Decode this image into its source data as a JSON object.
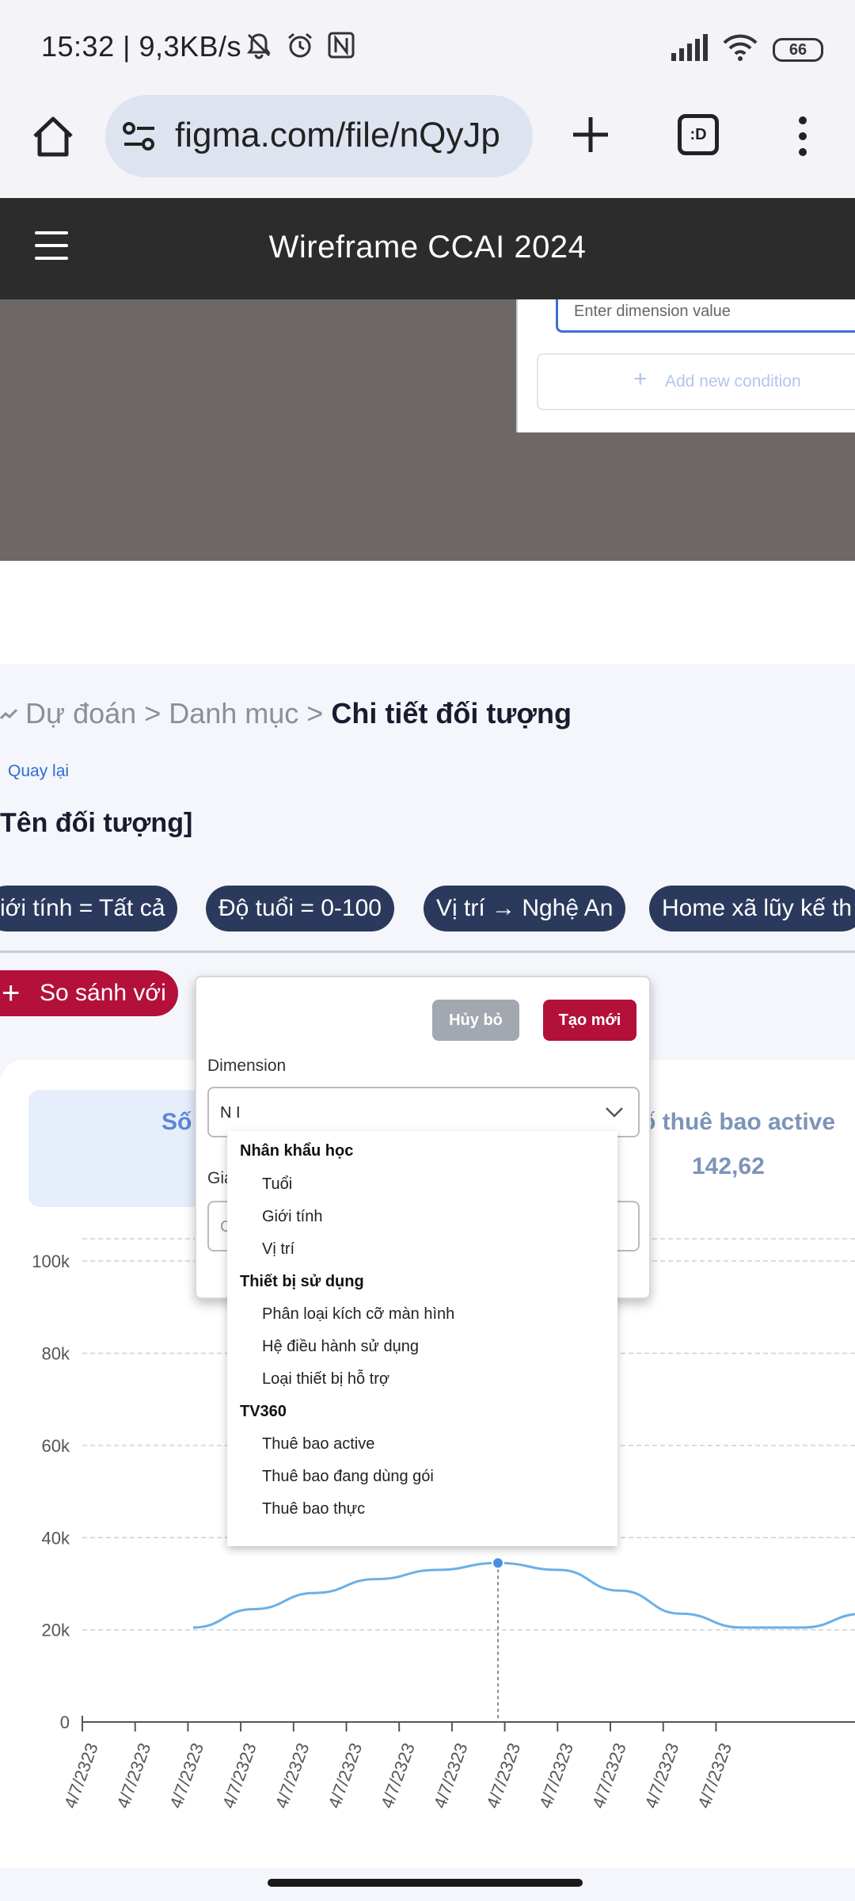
{
  "status_bar": {
    "time_speed": "15:32 | 9,3KB/s",
    "battery": "66",
    "icons": [
      "bell-off-icon",
      "alarm-icon",
      "nfc-icon",
      "signal-icon",
      "wifi-icon"
    ]
  },
  "browser": {
    "url": "figma.com/file/nQyJp",
    "tabs_label": ":D"
  },
  "app_header": {
    "title": "Wireframe CCAI 2024"
  },
  "figma_canvas": {
    "dimension_placeholder": "Enter dimension value",
    "add_condition": "Add new condition"
  },
  "page": {
    "breadcrumb_prefix": "Dự đoán > Danh mục > ",
    "breadcrumb_current": "Chi tiết đối tượng",
    "back": "Quay lại",
    "object_name": "Tên đối tượng]",
    "chips": [
      "iới tính = Tất cả",
      "Độ tuổi = 0-100",
      "Vị trí → Nghệ An",
      "Home xã lũy kế th"
    ],
    "compare_button": "So sánh với",
    "kpi_left_label": "Số",
    "kpi_right_label": "ố thuê bao active",
    "kpi_right_value": "142,62"
  },
  "popup": {
    "cancel": "Hủy bỏ",
    "create": "Tạo mới",
    "dimension_label": "Dimension",
    "dimension_value": "N I",
    "second_label": "Giá",
    "second_placeholder": "C"
  },
  "dropdown": {
    "groups": [
      {
        "title": "Nhân khẩu học",
        "items": [
          "Tuổi",
          "Giới tính",
          "Vị trí"
        ]
      },
      {
        "title": "Thiết bị sử dụng",
        "items": [
          "Phân loại kích cỡ màn hình",
          "Hệ điều hành sử dụng",
          "Loại thiết bị hỗ trợ"
        ]
      },
      {
        "title": "TV360",
        "items": [
          "Thuê bao active",
          "Thuê bao đang dùng gói",
          "Thuê bao thực"
        ]
      }
    ]
  },
  "chart_data": {
    "type": "line",
    "yticks": [
      "0",
      "20k",
      "40k",
      "60k",
      "80k",
      "100k"
    ],
    "ylim": [
      0,
      110000
    ],
    "xticks": [
      "4/7/2323",
      "4/7/2323",
      "4/7/2323",
      "4/7/2323",
      "4/7/2323",
      "4/7/2323",
      "4/7/2323",
      "4/7/2323",
      "4/7/2323",
      "4/7/2323",
      "4/7/2323",
      "4/7/2323",
      "4/7/2323"
    ],
    "series": [
      {
        "color": "#6ab0e8",
        "values": [
          20500,
          24500,
          28000,
          31000,
          33000,
          34500,
          33000,
          28500,
          23500,
          20500,
          20500,
          23500,
          26000
        ]
      }
    ],
    "highlight_index": 5,
    "grid": true
  }
}
